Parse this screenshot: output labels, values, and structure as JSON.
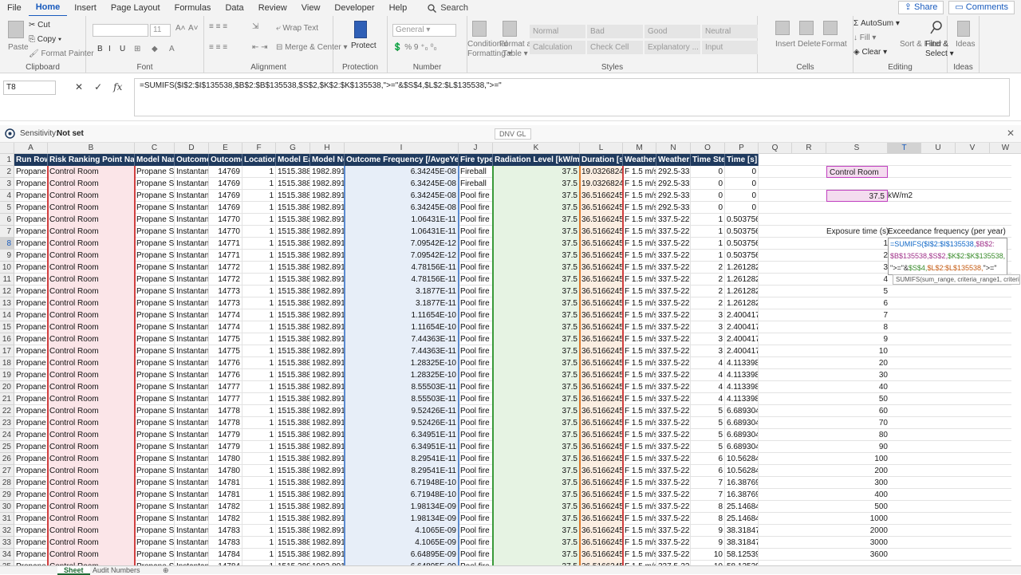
{
  "menu": {
    "items": [
      "File",
      "Home",
      "Insert",
      "Page Layout",
      "Formulas",
      "Data",
      "Review",
      "View",
      "Developer",
      "Help"
    ],
    "search": "Search",
    "share": "Share",
    "comments": "Comments"
  },
  "ribbon": {
    "clipboard": {
      "paste": "Paste",
      "cut": "Cut",
      "copy": "Copy",
      "painter": "Format Painter",
      "title": "Clipboard"
    },
    "font": {
      "size": "11",
      "title": "Font",
      "bold": "B",
      "italic": "I",
      "underline": "U"
    },
    "alignment": {
      "wrap": "Wrap Text",
      "merge": "Merge & Center",
      "title": "Alignment"
    },
    "protection": {
      "protect": "Protect",
      "title": "Protection"
    },
    "number": {
      "format": "General",
      "title": "Number"
    },
    "styles": {
      "cond": "Conditional Formatting",
      "table": "Format as Table",
      "normal": "Normal",
      "bad": "Bad",
      "good": "Good",
      "neutral": "Neutral",
      "calc": "Calculation",
      "check": "Check Cell",
      "explan": "Explanatory ...",
      "input": "Input",
      "title": "Styles"
    },
    "cells": {
      "insert": "Insert",
      "delete": "Delete",
      "format": "Format",
      "title": "Cells"
    },
    "editing": {
      "autosum": "AutoSum",
      "fill": "Fill",
      "clear": "Clear",
      "sort": "Sort & Filter",
      "find": "Find & Select",
      "title": "Editing"
    },
    "ideas": {
      "label": "Ideas",
      "title": "Ideas"
    }
  },
  "formula_bar": {
    "name": "T8",
    "fx": "fx",
    "formula": "=SUMIFS($I$2:$I$135538,$B$2:$B$135538,$S$2,$K$2:$K$135538,\">=\"&$S$4,$L$2:$L$135538,\">=\""
  },
  "sensitivity": {
    "label": "Sensitivity:",
    "value": "Not set",
    "company": "DNV GL"
  },
  "columns": [
    "A",
    "B",
    "C",
    "D",
    "E",
    "F",
    "G",
    "H",
    "I",
    "J",
    "K",
    "L",
    "M",
    "N",
    "O",
    "P",
    "Q",
    "R",
    "S",
    "T",
    "U",
    "V",
    "W"
  ],
  "headers": [
    "Run Row I",
    "Risk Ranking Point Name",
    "Model Nam",
    "Outcome",
    "Outcome",
    "Location I",
    "Model Ea",
    "Model No",
    "Outcome Frequency [/AvgeYear]",
    "Fire type",
    "Radiation Level [kW/m2]",
    "Duration [s]",
    "Weather I",
    "Weather I",
    "Time Step",
    "Time [s]"
  ],
  "rows": [
    [
      "Propane S",
      "Control Room",
      "Propane Sto",
      "Instantane",
      "14769",
      "1",
      "1515.388",
      "1982.891",
      "6.34245E-08",
      "Fireball",
      "37.5",
      "19.0326824",
      "F 1.5 m/s",
      "292.5-337.",
      "0",
      "0"
    ],
    [
      "Propane S",
      "Control Room",
      "Propane Sto",
      "Instantane",
      "14769",
      "1",
      "1515.388",
      "1982.891",
      "6.34245E-08",
      "Fireball",
      "37.5",
      "19.0326824",
      "F 1.5 m/s",
      "292.5-337.",
      "0",
      "0"
    ],
    [
      "Propane S",
      "Control Room",
      "Propane Sto",
      "Instantane",
      "14769",
      "1",
      "1515.388",
      "1982.891",
      "6.34245E-08",
      "Pool fire",
      "37.5",
      "36.5166245",
      "F 1.5 m/s",
      "292.5-337.",
      "0",
      "0"
    ],
    [
      "Propane S",
      "Control Room",
      "Propane Sto",
      "Instantane",
      "14769",
      "1",
      "1515.388",
      "1982.891",
      "6.34245E-08",
      "Pool fire",
      "37.5",
      "36.5166245",
      "F 1.5 m/s",
      "292.5-337.",
      "0",
      "0"
    ],
    [
      "Propane S",
      "Control Room",
      "Propane Sto",
      "Instantane",
      "14770",
      "1",
      "1515.388",
      "1982.891",
      "1.06431E-11",
      "Pool fire",
      "37.5",
      "36.5166245",
      "F 1.5 m/s",
      "337.5-22.5",
      "1",
      "0.503756"
    ],
    [
      "Propane S",
      "Control Room",
      "Propane Sto",
      "Instantane",
      "14770",
      "1",
      "1515.388",
      "1982.891",
      "1.06431E-11",
      "Pool fire",
      "37.5",
      "36.5166245",
      "F 1.5 m/s",
      "337.5-22.5",
      "1",
      "0.503756"
    ],
    [
      "Propane S",
      "Control Room",
      "Propane Sto",
      "Instantane",
      "14771",
      "1",
      "1515.388",
      "1982.891",
      "7.09542E-12",
      "Pool fire",
      "37.5",
      "36.5166245",
      "F 1.5 m/s",
      "337.5-22.5",
      "1",
      "0.503756"
    ],
    [
      "Propane S",
      "Control Room",
      "Propane Sto",
      "Instantane",
      "14771",
      "1",
      "1515.388",
      "1982.891",
      "7.09542E-12",
      "Pool fire",
      "37.5",
      "36.5166245",
      "F 1.5 m/s",
      "337.5-22.5",
      "1",
      "0.503756"
    ],
    [
      "Propane S",
      "Control Room",
      "Propane Sto",
      "Instantane",
      "14772",
      "1",
      "1515.388",
      "1982.891",
      "4.78156E-11",
      "Pool fire",
      "37.5",
      "36.5166245",
      "F 1.5 m/s",
      "337.5-22.5",
      "2",
      "1.261282"
    ],
    [
      "Propane S",
      "Control Room",
      "Propane Sto",
      "Instantane",
      "14772",
      "1",
      "1515.388",
      "1982.891",
      "4.78156E-11",
      "Pool fire",
      "37.5",
      "36.5166245",
      "F 1.5 m/s",
      "337.5-22.5",
      "2",
      "1.261282"
    ],
    [
      "Propane S",
      "Control Room",
      "Propane Sto",
      "Instantane",
      "14773",
      "1",
      "1515.388",
      "1982.891",
      "3.1877E-11",
      "Pool fire",
      "37.5",
      "36.5166245",
      "F 1.5 m/s",
      "337.5-22.5",
      "2",
      "1.261282"
    ],
    [
      "Propane S",
      "Control Room",
      "Propane Sto",
      "Instantane",
      "14773",
      "1",
      "1515.388",
      "1982.891",
      "3.1877E-11",
      "Pool fire",
      "37.5",
      "36.5166245",
      "F 1.5 m/s",
      "337.5-22.5",
      "2",
      "1.261282"
    ],
    [
      "Propane S",
      "Control Room",
      "Propane Sto",
      "Instantane",
      "14774",
      "1",
      "1515.388",
      "1982.891",
      "1.11654E-10",
      "Pool fire",
      "37.5",
      "36.5166245",
      "F 1.5 m/s",
      "337.5-22.5",
      "3",
      "2.400417"
    ],
    [
      "Propane S",
      "Control Room",
      "Propane Sto",
      "Instantane",
      "14774",
      "1",
      "1515.388",
      "1982.891",
      "1.11654E-10",
      "Pool fire",
      "37.5",
      "36.5166245",
      "F 1.5 m/s",
      "337.5-22.5",
      "3",
      "2.400417"
    ],
    [
      "Propane S",
      "Control Room",
      "Propane Sto",
      "Instantane",
      "14775",
      "1",
      "1515.388",
      "1982.891",
      "7.44363E-11",
      "Pool fire",
      "37.5",
      "36.5166245",
      "F 1.5 m/s",
      "337.5-22.5",
      "3",
      "2.400417"
    ],
    [
      "Propane S",
      "Control Room",
      "Propane Sto",
      "Instantane",
      "14775",
      "1",
      "1515.388",
      "1982.891",
      "7.44363E-11",
      "Pool fire",
      "37.5",
      "36.5166245",
      "F 1.5 m/s",
      "337.5-22.5",
      "3",
      "2.400417"
    ],
    [
      "Propane S",
      "Control Room",
      "Propane Sto",
      "Instantane",
      "14776",
      "1",
      "1515.388",
      "1982.891",
      "1.28325E-10",
      "Pool fire",
      "37.5",
      "36.5166245",
      "F 1.5 m/s",
      "337.5-22.5",
      "4",
      "4.113398"
    ],
    [
      "Propane S",
      "Control Room",
      "Propane Sto",
      "Instantane",
      "14776",
      "1",
      "1515.388",
      "1982.891",
      "1.28325E-10",
      "Pool fire",
      "37.5",
      "36.5166245",
      "F 1.5 m/s",
      "337.5-22.5",
      "4",
      "4.113398"
    ],
    [
      "Propane S",
      "Control Room",
      "Propane Sto",
      "Instantane",
      "14777",
      "1",
      "1515.388",
      "1982.891",
      "8.55503E-11",
      "Pool fire",
      "37.5",
      "36.5166245",
      "F 1.5 m/s",
      "337.5-22.5",
      "4",
      "4.113398"
    ],
    [
      "Propane S",
      "Control Room",
      "Propane Sto",
      "Instantane",
      "14777",
      "1",
      "1515.388",
      "1982.891",
      "8.55503E-11",
      "Pool fire",
      "37.5",
      "36.5166245",
      "F 1.5 m/s",
      "337.5-22.5",
      "4",
      "4.113398"
    ],
    [
      "Propane S",
      "Control Room",
      "Propane Sto",
      "Instantane",
      "14778",
      "1",
      "1515.388",
      "1982.891",
      "9.52426E-11",
      "Pool fire",
      "37.5",
      "36.5166245",
      "F 1.5 m/s",
      "337.5-22.5",
      "5",
      "6.689304"
    ],
    [
      "Propane S",
      "Control Room",
      "Propane Sto",
      "Instantane",
      "14778",
      "1",
      "1515.388",
      "1982.891",
      "9.52426E-11",
      "Pool fire",
      "37.5",
      "36.5166245",
      "F 1.5 m/s",
      "337.5-22.5",
      "5",
      "6.689304"
    ],
    [
      "Propane S",
      "Control Room",
      "Propane Sto",
      "Instantane",
      "14779",
      "1",
      "1515.388",
      "1982.891",
      "6.34951E-11",
      "Pool fire",
      "37.5",
      "36.5166245",
      "F 1.5 m/s",
      "337.5-22.5",
      "5",
      "6.689304"
    ],
    [
      "Propane S",
      "Control Room",
      "Propane Sto",
      "Instantane",
      "14779",
      "1",
      "1515.388",
      "1982.891",
      "6.34951E-11",
      "Pool fire",
      "37.5",
      "36.5166245",
      "F 1.5 m/s",
      "337.5-22.5",
      "5",
      "6.689304"
    ],
    [
      "Propane S",
      "Control Room",
      "Propane Sto",
      "Instantane",
      "14780",
      "1",
      "1515.388",
      "1982.891",
      "8.29541E-11",
      "Pool fire",
      "37.5",
      "36.5166245",
      "F 1.5 m/s",
      "337.5-22.5",
      "6",
      "10.56284"
    ],
    [
      "Propane S",
      "Control Room",
      "Propane Sto",
      "Instantane",
      "14780",
      "1",
      "1515.388",
      "1982.891",
      "8.29541E-11",
      "Pool fire",
      "37.5",
      "36.5166245",
      "F 1.5 m/s",
      "337.5-22.5",
      "6",
      "10.56284"
    ],
    [
      "Propane S",
      "Control Room",
      "Propane Sto",
      "Instantane",
      "14781",
      "1",
      "1515.388",
      "1982.891",
      "6.71948E-10",
      "Pool fire",
      "37.5",
      "36.5166245",
      "F 1.5 m/s",
      "337.5-22.5",
      "7",
      "16.38769"
    ],
    [
      "Propane S",
      "Control Room",
      "Propane Sto",
      "Instantane",
      "14781",
      "1",
      "1515.388",
      "1982.891",
      "6.71948E-10",
      "Pool fire",
      "37.5",
      "36.5166245",
      "F 1.5 m/s",
      "337.5-22.5",
      "7",
      "16.38769"
    ],
    [
      "Propane S",
      "Control Room",
      "Propane Sto",
      "Instantane",
      "14782",
      "1",
      "1515.388",
      "1982.891",
      "1.98134E-09",
      "Pool fire",
      "37.5",
      "36.5166245",
      "F 1.5 m/s",
      "337.5-22.5",
      "8",
      "25.14684"
    ],
    [
      "Propane S",
      "Control Room",
      "Propane Sto",
      "Instantane",
      "14782",
      "1",
      "1515.388",
      "1982.891",
      "1.98134E-09",
      "Pool fire",
      "37.5",
      "36.5166245",
      "F 1.5 m/s",
      "337.5-22.5",
      "8",
      "25.14684"
    ],
    [
      "Propane S",
      "Control Room",
      "Propane Sto",
      "Instantane",
      "14783",
      "1",
      "1515.388",
      "1982.891",
      "4.1065E-09",
      "Pool fire",
      "37.5",
      "36.5166245",
      "F 1.5 m/s",
      "337.5-22.5",
      "9",
      "38.31847"
    ],
    [
      "Propane S",
      "Control Room",
      "Propane Sto",
      "Instantane",
      "14783",
      "1",
      "1515.388",
      "1982.891",
      "4.1065E-09",
      "Pool fire",
      "37.5",
      "36.5166245",
      "F 1.5 m/s",
      "337.5-22.5",
      "9",
      "38.31847"
    ],
    [
      "Propane S",
      "Control Room",
      "Propane Sto",
      "Instantane",
      "14784",
      "1",
      "1515.388",
      "1982.891",
      "6.64895E-09",
      "Pool fire",
      "37.5",
      "36.5166245",
      "F 1.5 m/s",
      "337.5-22.5",
      "10",
      "58.12539"
    ],
    [
      "Propane S",
      "Control Room",
      "Propane Sto",
      "Instantane",
      "14784",
      "1",
      "1515.388",
      "1982.891",
      "6.64895E-09",
      "Pool fire",
      "37.5",
      "36.5166245",
      "F 1.5 m/s",
      "337.5-22.5",
      "10",
      "58.12539"
    ]
  ],
  "side": {
    "location": "Control Room",
    "radiation": "37.5",
    "radiation_unit": "kW/m2",
    "exposure_header": "Exposure time (s)",
    "freq_header": "Exceedance frequency (per year)",
    "exposure_times": [
      "1",
      "2",
      "3",
      "4",
      "5",
      "6",
      "7",
      "8",
      "9",
      "10",
      "20",
      "30",
      "40",
      "50",
      "60",
      "70",
      "80",
      "90",
      "100",
      "200",
      "300",
      "400",
      "500",
      "1000",
      "2000",
      "3000",
      "3600"
    ],
    "edit_lines": [
      "=SUMIFS($I$2:$I$135538,$B$2:",
      "$B$135538,$S$2,$K$2:$K$135538,",
      "\">=\"&$S$4,$L$2:$L$135538,\">=\""
    ],
    "tooltip": "SUMIFS(sum_range, criteria_range1, criteria1, ...)"
  },
  "sheets": [
    "Sheet",
    "Audit Numbers"
  ]
}
